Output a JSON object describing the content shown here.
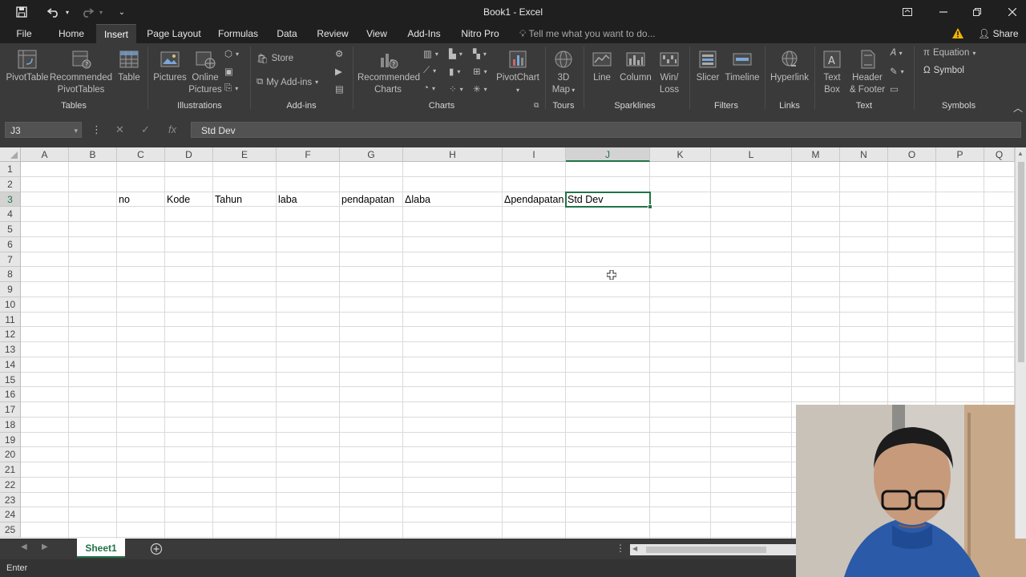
{
  "window": {
    "title": "Book1 - Excel"
  },
  "tabs": [
    {
      "label": "File",
      "active": false
    },
    {
      "label": "Home",
      "active": false
    },
    {
      "label": "Insert",
      "active": true
    },
    {
      "label": "Page Layout",
      "active": false
    },
    {
      "label": "Formulas",
      "active": false
    },
    {
      "label": "Data",
      "active": false
    },
    {
      "label": "Review",
      "active": false
    },
    {
      "label": "View",
      "active": false
    },
    {
      "label": "Add-Ins",
      "active": false
    },
    {
      "label": "Nitro Pro",
      "active": false
    }
  ],
  "tell_me": "Tell me what you want to do...",
  "share_label": "Share",
  "ribbon": {
    "tables": {
      "group": "Tables",
      "pivottable_1": "PivotTable",
      "recommended_1": "Recommended",
      "recommended_2": "PivotTables",
      "table": "Table"
    },
    "illustrations": {
      "group": "Illustrations",
      "pictures": "Pictures",
      "online_1": "Online",
      "online_2": "Pictures"
    },
    "addins": {
      "group": "Add-ins",
      "store": "Store",
      "my_addins": "My Add-ins"
    },
    "charts": {
      "group": "Charts",
      "recommended_1": "Recommended",
      "recommended_2": "Charts",
      "pivotchart": "PivotChart"
    },
    "tours": {
      "group": "Tours",
      "map_1": "3D",
      "map_2": "Map"
    },
    "sparklines": {
      "group": "Sparklines",
      "line": "Line",
      "column": "Column",
      "winloss_1": "Win/",
      "winloss_2": "Loss"
    },
    "filters": {
      "group": "Filters",
      "slicer": "Slicer",
      "timeline": "Timeline"
    },
    "links": {
      "group": "Links",
      "hyperlink": "Hyperlink"
    },
    "text": {
      "group": "Text",
      "textbox_1": "Text",
      "textbox_2": "Box",
      "header_1": "Header",
      "header_2": "& Footer"
    },
    "symbols": {
      "group": "Symbols",
      "equation": "Equation",
      "symbol": "Symbol"
    }
  },
  "formula_bar": {
    "name_box": "J3",
    "formula": "Std Dev"
  },
  "grid": {
    "columns": [
      "A",
      "B",
      "C",
      "D",
      "E",
      "F",
      "G",
      "H",
      "I",
      "J",
      "K",
      "L",
      "M",
      "N",
      "O",
      "P",
      "Q"
    ],
    "rows": [
      "1",
      "2",
      "3",
      "4",
      "5",
      "6",
      "7",
      "8",
      "9",
      "10",
      "11",
      "12",
      "13",
      "14",
      "15",
      "16",
      "17",
      "18",
      "19",
      "20",
      "21",
      "22",
      "23",
      "24",
      "25"
    ],
    "active_cell": "J3",
    "row3": {
      "C": "no",
      "D": "Kode",
      "E": "Tahun",
      "F": "laba",
      "G": "pendapatan",
      "H": "Δlaba",
      "I": "Δpendapatan",
      "J": "Std Dev"
    }
  },
  "sheets": [
    {
      "label": "Sheet1",
      "active": true
    }
  ],
  "status": {
    "mode": "Enter"
  },
  "colors": {
    "accent": "#217346",
    "chrome_dark": "#1f1f1f",
    "ribbon": "#3a3a3a"
  }
}
